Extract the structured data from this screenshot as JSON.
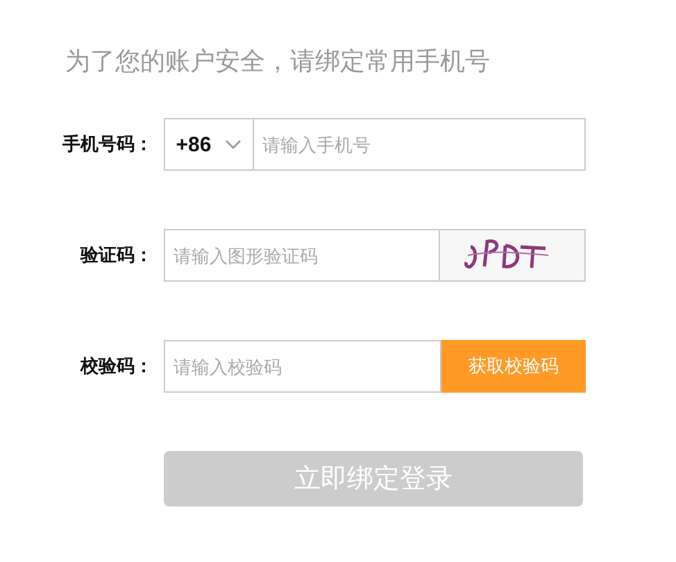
{
  "heading": "为了您的账户安全，请绑定常用手机号",
  "fields": [
    {
      "kind": "phone",
      "label": "手机号码：",
      "prefix": "+86",
      "placeholder": "请输入手机号"
    },
    {
      "kind": "captcha",
      "label": "验证码：",
      "placeholder": "请输入图形验证码"
    },
    {
      "kind": "code",
      "label": "校验码：",
      "placeholder": "请输入校验码",
      "button": "获取校验码"
    }
  ],
  "submit": {
    "label": "立即绑定登录",
    "disabled": true
  }
}
